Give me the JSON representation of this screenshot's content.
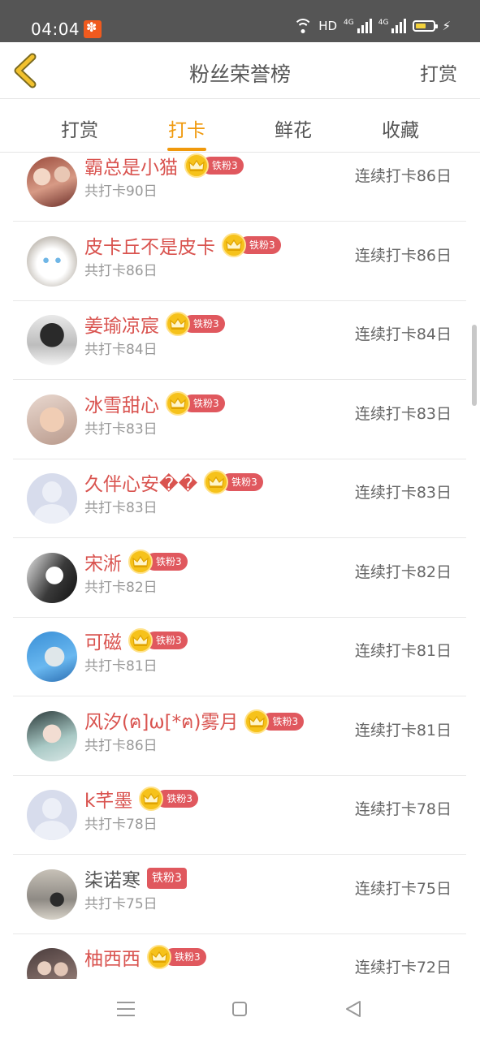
{
  "status_bar": {
    "time": "04:04",
    "network_label": "HD",
    "sim1": "4G",
    "sim2": "4G"
  },
  "header": {
    "title": "粉丝荣誉榜",
    "right_action": "打赏"
  },
  "tabs": [
    {
      "label": "打赏",
      "active": false
    },
    {
      "label": "打卡",
      "active": true
    },
    {
      "label": "鲜花",
      "active": false
    },
    {
      "label": "收藏",
      "active": false
    }
  ],
  "colors": {
    "accent": "#f0990c",
    "name_red": "#d9534f",
    "badge_red": "#e0585e",
    "crown_gold": "#f6c21b"
  },
  "list": [
    {
      "name": "霸总是小猫",
      "badge": "铁粉3",
      "crown": true,
      "total": "共打卡90日",
      "streak": "连续打卡86日",
      "avatar": "photo-children"
    },
    {
      "name": "皮卡丘不是皮卡",
      "badge": "铁粉3",
      "crown": true,
      "total": "共打卡86日",
      "streak": "连续打卡86日",
      "avatar": "photo-cat"
    },
    {
      "name": "姜瑜凉宸",
      "badge": "铁粉3",
      "crown": true,
      "total": "共打卡84日",
      "streak": "连续打卡84日",
      "avatar": "photo-girl-bw"
    },
    {
      "name": "冰雪甜心",
      "badge": "铁粉3",
      "crown": true,
      "total": "共打卡83日",
      "streak": "连续打卡83日",
      "avatar": "photo-baby"
    },
    {
      "name": "久伴心安��",
      "badge": "铁粉3",
      "crown": true,
      "total": "共打卡83日",
      "streak": "连续打卡83日",
      "avatar": "default-avatar"
    },
    {
      "name": "宋淅",
      "badge": "铁粉3",
      "crown": true,
      "total": "共打卡82日",
      "streak": "连续打卡82日",
      "avatar": "photo-sketch"
    },
    {
      "name": "可磁",
      "badge": "铁粉3",
      "crown": true,
      "total": "共打卡81日",
      "streak": "连续打卡81日",
      "avatar": "photo-anime-blue"
    },
    {
      "name": "风汐(ฅ]ω[*ฅ)雾月",
      "badge": "铁粉3",
      "crown": true,
      "total": "共打卡86日",
      "streak": "连续打卡81日",
      "avatar": "photo-actress"
    },
    {
      "name": "k芊墨",
      "badge": "铁粉3",
      "crown": true,
      "total": "共打卡78日",
      "streak": "连续打卡78日",
      "avatar": "default-avatar"
    },
    {
      "name": "柒诺寒",
      "badge": "铁粉3",
      "crown": false,
      "total": "共打卡75日",
      "streak": "连续打卡75日",
      "avatar": "photo-sky"
    },
    {
      "name": "柚西西",
      "badge": "铁粉3",
      "crown": true,
      "total": "",
      "streak": "连续打卡72日",
      "avatar": "photo-couple"
    }
  ]
}
